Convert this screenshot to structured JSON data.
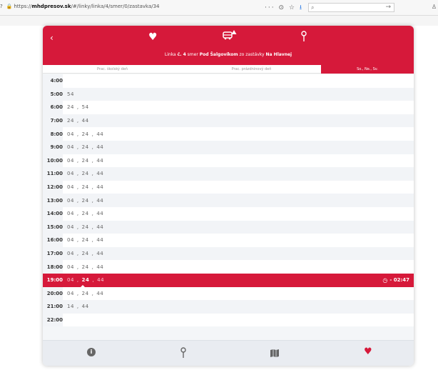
{
  "browser": {
    "url_prefix": "https://",
    "url_domain": "mhdpresov.sk",
    "url_path": "/#/linky/linka/4/smer/0/zastavka/34",
    "search_placeholder": ""
  },
  "header": {
    "subtitle_pre": "Linka ",
    "line_no": "č. 4",
    "subtitle_mid": " smer ",
    "direction": "Pod Šalgovíkom",
    "subtitle_mid2": " zo zastávky ",
    "stop": "Na Hlavnej"
  },
  "tabs": [
    {
      "label": "Prac. školský deň"
    },
    {
      "label": "Prac. prázdninový deň"
    },
    {
      "label": "So., Ne., Sv."
    }
  ],
  "rows": [
    {
      "hour": "4:00",
      "mins": []
    },
    {
      "hour": "5:00",
      "mins": [
        "54"
      ]
    },
    {
      "hour": "6:00",
      "mins": [
        "24",
        "54"
      ]
    },
    {
      "hour": "7:00",
      "mins": [
        "24",
        "44"
      ]
    },
    {
      "hour": "8:00",
      "mins": [
        "04",
        "24",
        "44"
      ]
    },
    {
      "hour": "9:00",
      "mins": [
        "04",
        "24",
        "44"
      ]
    },
    {
      "hour": "10:00",
      "mins": [
        "04",
        "24",
        "44"
      ]
    },
    {
      "hour": "11:00",
      "mins": [
        "04",
        "24",
        "44"
      ]
    },
    {
      "hour": "12:00",
      "mins": [
        "04",
        "24",
        "44"
      ]
    },
    {
      "hour": "13:00",
      "mins": [
        "04",
        "24",
        "44"
      ]
    },
    {
      "hour": "14:00",
      "mins": [
        "04",
        "24",
        "44"
      ]
    },
    {
      "hour": "15:00",
      "mins": [
        "04",
        "24",
        "44"
      ]
    },
    {
      "hour": "16:00",
      "mins": [
        "04",
        "24",
        "44"
      ]
    },
    {
      "hour": "17:00",
      "mins": [
        "04",
        "24",
        "44"
      ]
    },
    {
      "hour": "18:00",
      "mins": [
        "04",
        "24",
        "44"
      ]
    },
    {
      "hour": "19:00",
      "mins": [
        "04",
        "24",
        "44"
      ],
      "current": true,
      "next_index": 1,
      "countdown": "- 02:47"
    },
    {
      "hour": "20:00",
      "mins": [
        "04",
        "24",
        "44"
      ]
    },
    {
      "hour": "21:00",
      "mins": [
        "14",
        "44"
      ]
    },
    {
      "hour": "22:00",
      "mins": []
    }
  ],
  "colors": {
    "accent": "#d6193a"
  },
  "icons": {
    "header": [
      "back-chevron-icon",
      "heart-icon",
      "bus-alert-icon",
      "stop-pin-icon"
    ],
    "bottom": [
      "info-icon",
      "stop-pin-icon",
      "map-icon",
      "heart-icon"
    ]
  }
}
